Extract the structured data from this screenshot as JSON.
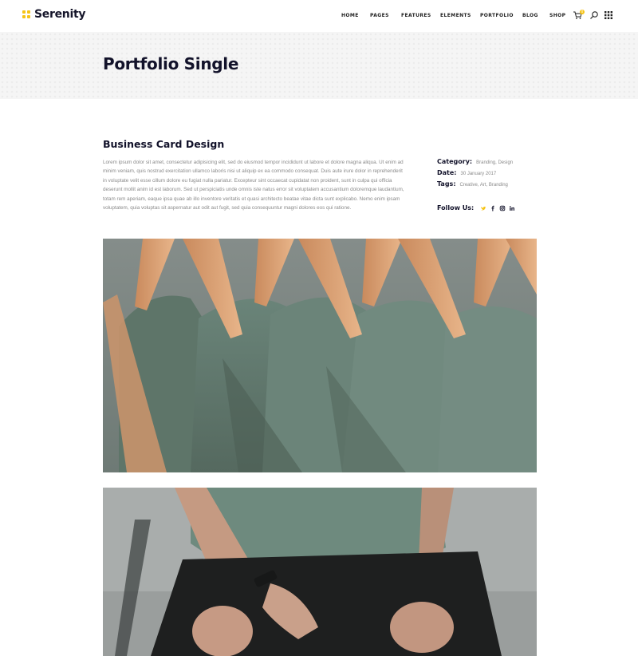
{
  "header": {
    "logo_text": "Serenity",
    "nav": [
      "HOME",
      "PAGES",
      "FEATURES",
      "ELEMENTS",
      "PORTFOLIO",
      "BLOG",
      "SHOP"
    ],
    "cart_count": "0",
    "icons": [
      "cart-icon",
      "search-icon",
      "grid-menu-icon"
    ],
    "accent_color": "#f6c416"
  },
  "title_band": {
    "title": "Portfolio Single"
  },
  "project": {
    "title": "Business Card Design",
    "description": "Lorem ipsum dolor sit amet, consectetur adipisicing elit, sed do eiusmod tempor incididunt ut labore et dolore magna aliqua. Ut enim ad minim veniam, quis nostrud exercitation ullamco laboris nisi ut aliquip ex ea commodo consequat. Duis aute irure dolor in reprehenderit in voluptate velit esse cillum dolore eu fugiat nulla pariatur. Excepteur sint occaecat cupidatat non proident, sunt in culpa qui officia deserunt mollit anim id est laborum. Sed ut perspiciatis unde omnis iste natus error sit voluptatem accusantium doloremque laudantium, totam rem aperiam, eaque ipsa quae ab illo inventore veritatis et quasi architecto beatae vitae dicta sunt explicabo. Nemo enim ipsam voluptatem, quia voluptas sit aspernatur aut odit aut fugit, sed quia consequuntur magni dolores eos qui ratione.",
    "meta": {
      "category_label": "Category:",
      "category_value": "Branding, Design",
      "date_label": "Date:",
      "date_value": "30 January 2017",
      "tags_label": "Tags:",
      "tags_value": "Creative, Art, Branding",
      "follow_label": "Follow Us:",
      "social": [
        "twitter-icon",
        "facebook-icon",
        "instagram-icon",
        "linkedin-icon"
      ]
    }
  }
}
